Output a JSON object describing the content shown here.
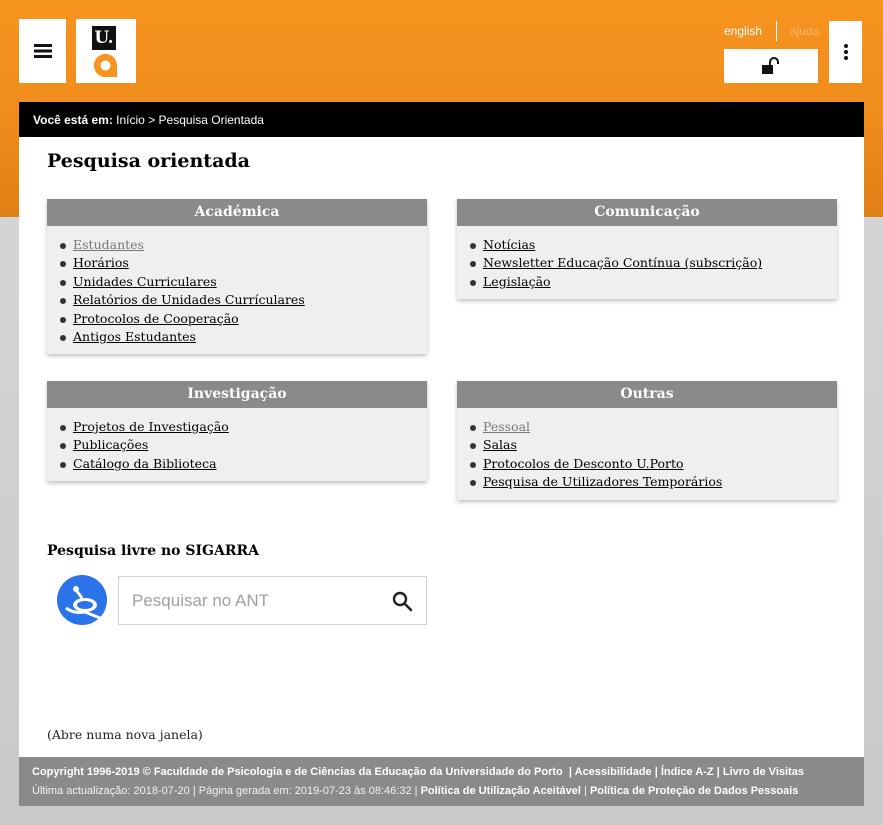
{
  "header": {
    "logo_text": "U.",
    "lang_english": "english",
    "lang_help": "ajuda"
  },
  "breadcrumb": {
    "prefix": "Você está em:",
    "home": "Início",
    "separator": " > ",
    "current": "Pesquisa Orientada"
  },
  "page": {
    "title": "Pesquisa orientada"
  },
  "sections": {
    "academica": {
      "title": "Académica",
      "items": [
        "Estudantes",
        "Horários",
        "Unidades Curriculares",
        "Relatórios de Unidades Currículares",
        "Protocolos de Cooperação",
        "Antigos Estudantes"
      ]
    },
    "comunicacao": {
      "title": "Comunicação",
      "items": [
        "Notícias",
        "Newsletter Educação Contínua (subscrição)",
        "Legislação"
      ]
    },
    "investigacao": {
      "title": "Investigação",
      "items": [
        "Projetos de Investigação",
        "Publicações",
        "Catálogo da Biblioteca"
      ]
    },
    "outras": {
      "title": "Outras",
      "items": [
        "Pessoal",
        "Salas",
        "Protocolos de Desconto U.Porto",
        "Pesquisa de Utilizadores Temporários"
      ]
    }
  },
  "free_search": {
    "title": "Pesquisa livre no SIGARRA",
    "placeholder": "Pesquisar no ANT"
  },
  "note": "(Abre numa nova janela)",
  "footer": {
    "copyright": "Copyright 1996-2019 © Faculdade de Psicologia e de Ciências da Educação da Universidade do Porto",
    "acessibilidade": "Acessibilidade",
    "indice": "Índice A-Z",
    "livro": "Livro de Visitas",
    "ultima": "Última actualização: 2018-07-20",
    "gerada": "Página gerada em: 2019-07-23 às 08:46:32",
    "politica_uso": "Política de Utilização Aceitável",
    "politica_dados": "Política de Proteção de Dados Pessoais"
  },
  "colors": {
    "brand_orange": "#f7931e",
    "header_gray": "#8a8a8a"
  },
  "icons": [
    "menu-icon",
    "lock-open-icon",
    "more-vertical-icon",
    "search-icon",
    "ant-logo-icon"
  ]
}
